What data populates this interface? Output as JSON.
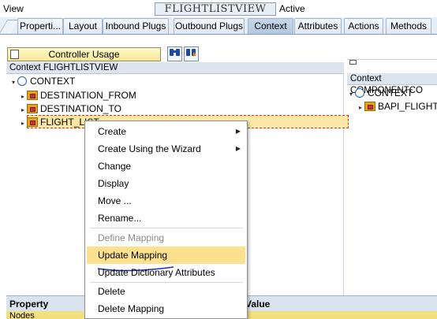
{
  "header": {
    "left_label": "View",
    "view_name": "FLIGHTLISTVIEW",
    "status": "Active"
  },
  "tabs": [
    {
      "label": "Properti..."
    },
    {
      "label": "Layout"
    },
    {
      "label": "Inbound Plugs"
    },
    {
      "label": "Outbound Plugs"
    },
    {
      "label": "Context"
    },
    {
      "label": "Attributes"
    },
    {
      "label": "Actions"
    },
    {
      "label": "Methods"
    }
  ],
  "toolbar": {
    "controller_usage_label": "Controller Usage",
    "icons": [
      "binoculars-icon",
      "find-next-icon"
    ]
  },
  "left_context": {
    "title": "Context FLIGHTLISTVIEW",
    "root": "CONTEXT",
    "nodes": [
      {
        "label": "DESTINATION_FROM"
      },
      {
        "label": "DESTINATION_TO"
      },
      {
        "label": "FLIGHT_LIST"
      }
    ]
  },
  "right_context": {
    "title": "Context COMPONENTCO",
    "root": "CONTEXT",
    "nodes": [
      {
        "label": "BAPI_FLIGHT_"
      }
    ]
  },
  "context_menu": {
    "items": [
      {
        "label": "Create",
        "submenu": true,
        "enabled": true
      },
      {
        "label": "Create Using the Wizard",
        "submenu": true,
        "enabled": true
      },
      {
        "label": "Change",
        "enabled": true
      },
      {
        "label": "Display",
        "enabled": true
      },
      {
        "label": "Move ...",
        "enabled": true
      },
      {
        "label": "Rename...",
        "enabled": true
      },
      {
        "label": "Define Mapping",
        "enabled": false
      },
      {
        "label": "Update Mapping",
        "enabled": true,
        "highlighted": true
      },
      {
        "label": "Update Dictionary Attributes",
        "enabled": true
      },
      {
        "label": "Delete",
        "enabled": true
      },
      {
        "label": "Delete Mapping",
        "enabled": true
      }
    ]
  },
  "property_table": {
    "col_property": "Property",
    "col_value": "Value",
    "first_row": "Nodes"
  },
  "colors": {
    "tab_bg": "#e5edf7",
    "menu_highlight": "#fbe08e",
    "selection_bg": "#fde7a6",
    "annotation_line": "#1f2fa8"
  }
}
